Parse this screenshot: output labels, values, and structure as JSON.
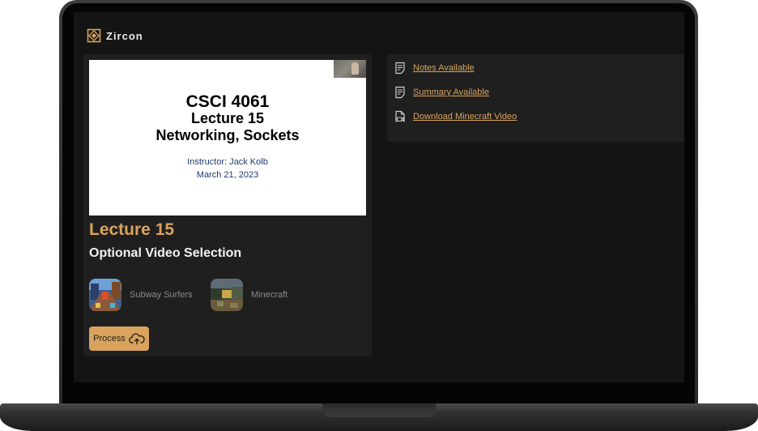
{
  "app": {
    "name": "Zircon",
    "logo_icon": "zircon-logo-icon"
  },
  "colors": {
    "accent": "#d9a35d",
    "background": "#141414",
    "card": "#1f1f1f",
    "text": "#f2f2f2",
    "muted": "#8a8a8a"
  },
  "slide": {
    "course": "CSCI 4061",
    "lecture": "Lecture 15",
    "topic": "Networking, Sockets",
    "instructor": "Instructor: Jack Kolb",
    "date": "March 21, 2023"
  },
  "lecture_title": "Lecture 15",
  "video_selection": {
    "title": "Optional Video Selection",
    "options": [
      {
        "label": "Subway Surfers",
        "icon": "subway-surfers-thumbnail"
      },
      {
        "label": "Minecraft",
        "icon": "minecraft-thumbnail"
      }
    ]
  },
  "process_button": {
    "label": "Process",
    "icon": "cloud-upload-icon"
  },
  "links": [
    {
      "label": "Notes Available",
      "icon": "notes-icon"
    },
    {
      "label": "Summary Available",
      "icon": "summary-icon"
    },
    {
      "label": "Download Minecraft Video",
      "icon": "video-file-icon"
    }
  ]
}
